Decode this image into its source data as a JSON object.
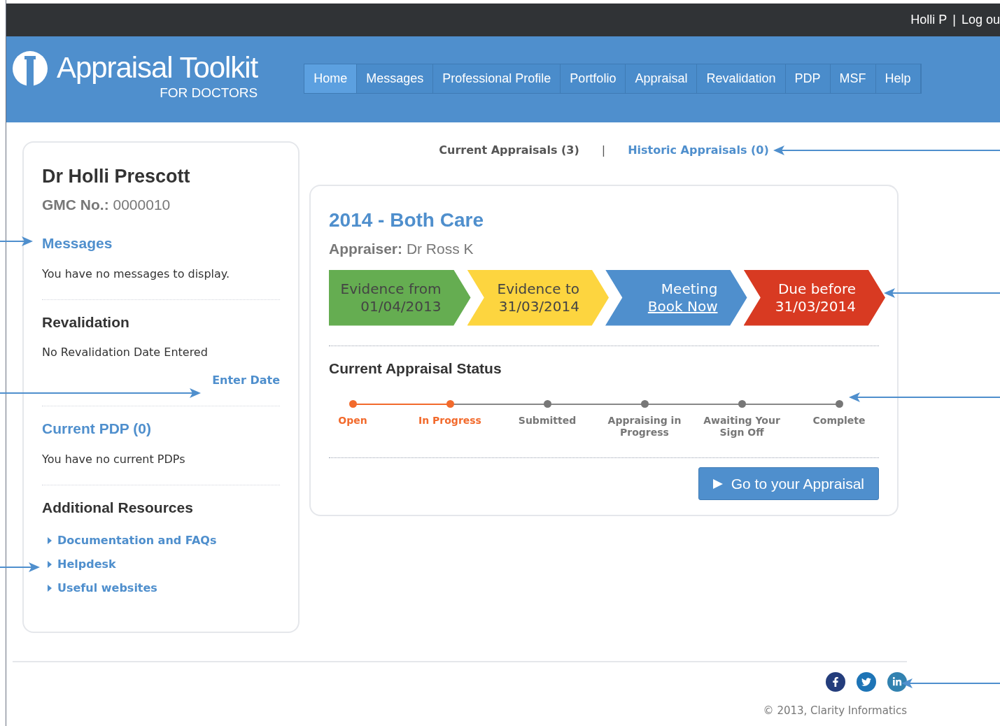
{
  "top_bar": {
    "user": "Holli P",
    "separator": "|",
    "logout": "Log ou"
  },
  "brand": {
    "title": "Appraisal Toolkit",
    "subtitle": "FOR DOCTORS"
  },
  "nav": [
    {
      "label": "Home",
      "selected": true
    },
    {
      "label": "Messages",
      "selected": false
    },
    {
      "label": "Professional Profile",
      "selected": false
    },
    {
      "label": "Portfolio",
      "selected": false
    },
    {
      "label": "Appraisal",
      "selected": false
    },
    {
      "label": "Revalidation",
      "selected": false
    },
    {
      "label": "PDP",
      "selected": false
    },
    {
      "label": "MSF",
      "selected": false
    },
    {
      "label": "Help",
      "selected": false
    }
  ],
  "sidebar": {
    "name": "Dr Holli Prescott",
    "gmc_label": "GMC No.:",
    "gmc_value": "0000010",
    "sections": [
      {
        "kind": "messages",
        "title": "Messages",
        "text": "You have no messages to display."
      },
      {
        "kind": "revalidation",
        "title": "Revalidation",
        "text": "No Revalidation Date Entered",
        "action": "Enter Date"
      },
      {
        "kind": "pdp",
        "title": "Current PDP (0)",
        "text": "You have no current PDPs"
      },
      {
        "kind": "resources",
        "title": "Additional Resources",
        "links": [
          "Documentation and FAQs",
          "Helpdesk",
          "Useful websites"
        ]
      }
    ]
  },
  "appraisal_tabs": [
    {
      "label": "Current Appraisals (3)",
      "selected": true
    },
    {
      "label": "Historic Appraisals (0)",
      "selected": false
    }
  ],
  "appraisal_tabs_separator": "|",
  "appraisal": {
    "title": "2014 - Both Care",
    "appraiser_label": "Appraiser:",
    "appraiser": "Dr Ross K",
    "timeline": [
      {
        "line1": "Evidence from",
        "line2": "01/04/2013",
        "color": "#65ad51",
        "kind": "text"
      },
      {
        "line1": "Evidence to",
        "line2": "31/03/2014",
        "color": "#fdd53f",
        "kind": "text"
      },
      {
        "line1": "Meeting",
        "line2": "Book Now",
        "color": "#4f8fcd",
        "kind": "link"
      },
      {
        "line1": "Due before",
        "line2": "31/03/2014",
        "color": "#d83a22",
        "kind": "text"
      }
    ],
    "status_title": "Current Appraisal Status",
    "steps": [
      {
        "label": "Open",
        "reached": true
      },
      {
        "label": "In Progress",
        "reached": true
      },
      {
        "label": "Submitted",
        "reached": false
      },
      {
        "label": "Appraising in Progress",
        "reached": false
      },
      {
        "label": "Awaiting Your Sign Off",
        "reached": false
      },
      {
        "label": "Complete",
        "reached": false
      }
    ],
    "button": "Go to your Appraisal"
  },
  "footer": {
    "copyright": "© 2013, Clarity Informatics"
  }
}
